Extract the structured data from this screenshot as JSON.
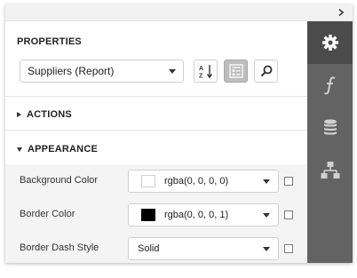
{
  "colors": {
    "rail_bg": "#636363",
    "rail_active_bg": "#4b4b4b",
    "rail_icon": "#ffffff",
    "property_area_bg": "#f4f4f4"
  },
  "topbar": {
    "collapse_icon": "chevron-right-icon"
  },
  "properties": {
    "title": "PROPERTIES",
    "report_select": {
      "value": "Suppliers (Report)"
    },
    "tools": [
      {
        "name": "sort-alphabetical-icon",
        "pressed": false
      },
      {
        "name": "categorized-view-icon",
        "pressed": true
      },
      {
        "name": "search-icon",
        "pressed": false
      }
    ]
  },
  "groups": {
    "actions": {
      "label": "ACTIONS",
      "expanded": false
    },
    "appearance": {
      "label": "APPEARANCE",
      "expanded": true
    }
  },
  "rows": [
    {
      "label": "Background Color",
      "value": "rgba(0, 0, 0, 0)",
      "swatch": "#ffffff"
    },
    {
      "label": "Border Color",
      "value": "rgba(0, 0, 0, 1)",
      "swatch": "#000000"
    },
    {
      "label": "Border Dash Style",
      "value": "Solid"
    }
  ],
  "rail": [
    {
      "name": "gear-icon",
      "active": true
    },
    {
      "name": "function-icon",
      "active": false
    },
    {
      "name": "database-icon",
      "active": false
    },
    {
      "name": "hierarchy-icon",
      "active": false
    }
  ]
}
